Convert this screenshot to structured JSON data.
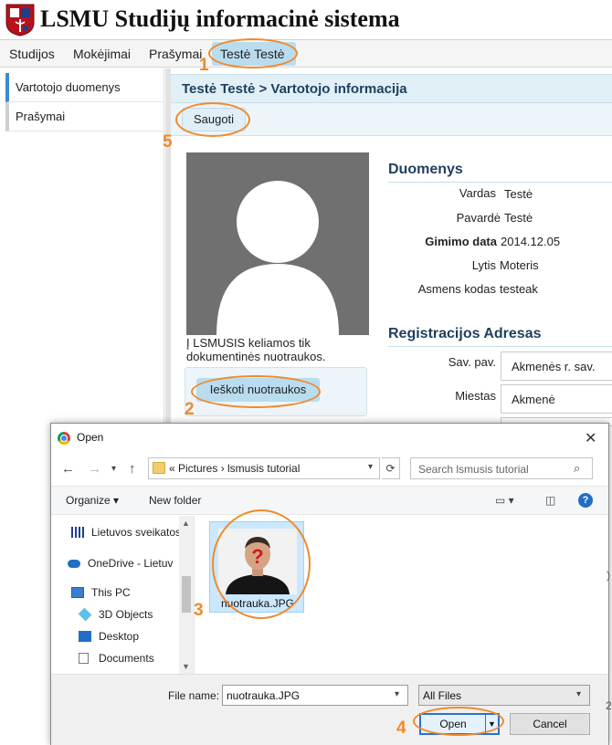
{
  "header": {
    "site_title": "LSMU Studijų informacinė sistema"
  },
  "topnav": {
    "items": [
      "Studijos",
      "Mokėjimai",
      "Prašymai",
      "Testė Testė"
    ]
  },
  "sidebar": {
    "items": [
      "Vartotojo duomenys",
      "Prašymai"
    ]
  },
  "main": {
    "breadcrumb": "Testė Testė > Vartotojo informacija",
    "save_label": "Saugoti",
    "photo_note": "Į LSMUSIS keliamos tik dokumentinės nuotraukos.",
    "upload_label": "Ieškoti nuotraukos",
    "data_section": {
      "title": "Duomenys",
      "fields": [
        {
          "label": "Vardas",
          "value": "Testė"
        },
        {
          "label": "Pavardė",
          "value": "Testė"
        },
        {
          "label": "Gimimo data",
          "value": "2014.12.05"
        },
        {
          "label": "Lytis",
          "value": "Moteris"
        },
        {
          "label": "Asmens kodas",
          "value": "testeak"
        }
      ]
    },
    "address_section": {
      "title": "Registracijos Adresas",
      "fields": [
        {
          "label": "Sav. pav.",
          "value": "Akmenės r. sav."
        },
        {
          "label": "Miestas",
          "value": "Akmenė"
        }
      ]
    }
  },
  "dialog": {
    "title": "Open",
    "close": "✕",
    "path": "«  Pictures  ›  lsmusis tutorial",
    "search_placeholder": "Search lsmusis tutorial",
    "organize_label": "Organize ▾",
    "new_folder_label": "New folder",
    "nav_items": [
      "Lietuvos sveikatos",
      "OneDrive - Lietuv",
      "This PC",
      "3D Objects",
      "Desktop",
      "Documents"
    ],
    "file": {
      "name": "nuotrauka.JPG"
    },
    "filename_label": "File name:",
    "filename_value": "nuotrauka.JPG",
    "filetype_value": "All Files",
    "open_label": "Open",
    "cancel_label": "Cancel"
  },
  "annotations": {
    "numbers": [
      "1",
      "2",
      "3",
      "4",
      "5"
    ],
    "color": "#f08a2a"
  },
  "colors": {
    "accent": "#b9dcef",
    "title": "#1e3f5f",
    "panel": "#e1eff6"
  }
}
